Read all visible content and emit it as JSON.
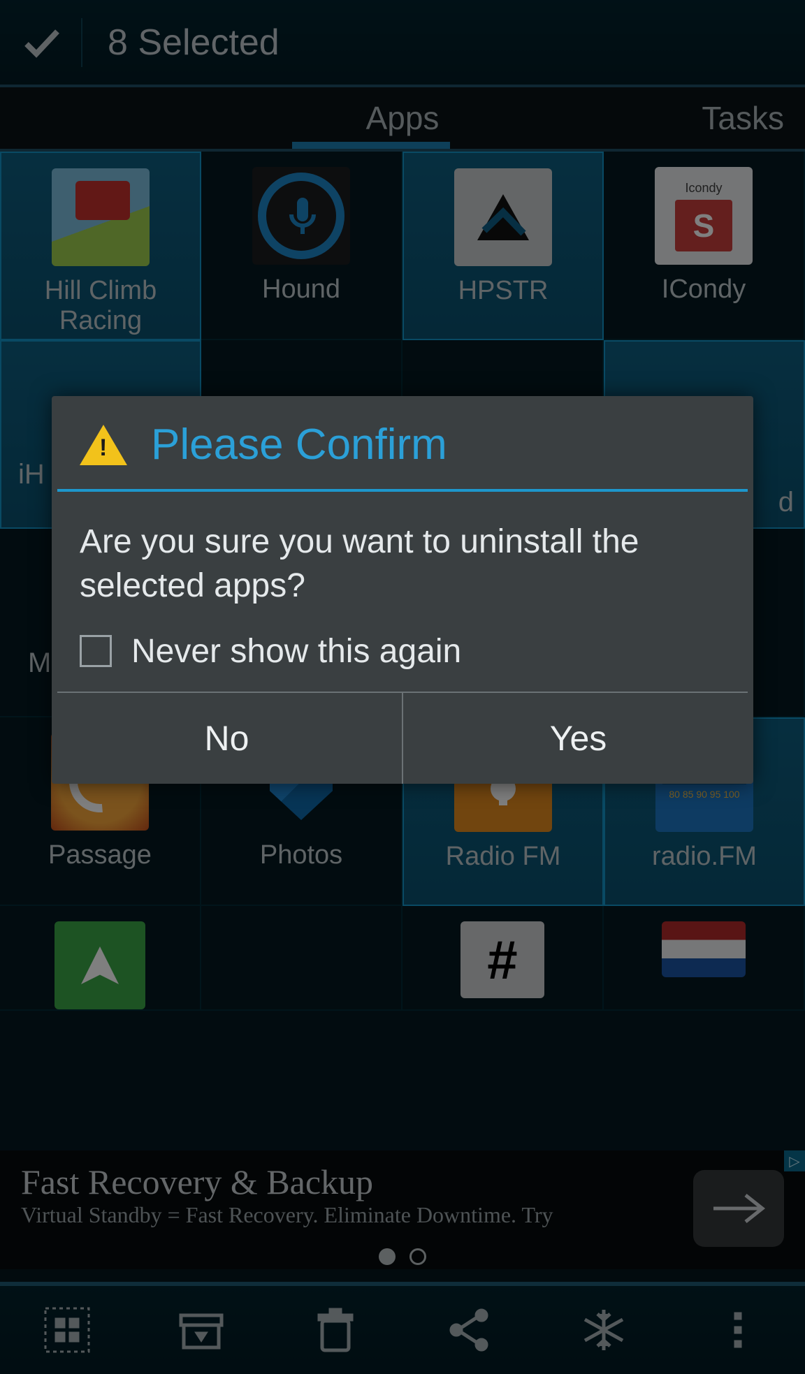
{
  "header": {
    "title": "8 Selected"
  },
  "tabs": {
    "apps": "Apps",
    "tasks": "Tasks"
  },
  "apps": {
    "row1": [
      {
        "label": "Hill Climb Racing",
        "selected": true,
        "icon": "ic-hill"
      },
      {
        "label": "Hound",
        "selected": false,
        "icon": "ic-hound"
      },
      {
        "label": "HPSTR",
        "selected": true,
        "icon": "ic-hpstr"
      },
      {
        "label": "ICondy",
        "selected": false,
        "icon": "ic-icondy"
      }
    ],
    "row2_fragments": {
      "left": "iH",
      "right": "d",
      "mid_left": "M"
    },
    "row4": [
      {
        "label": "Passage",
        "selected": false,
        "icon": "ic-passage"
      },
      {
        "label": "Photos",
        "selected": false,
        "icon": "ic-photos"
      },
      {
        "label": "Radio FM",
        "selected": true,
        "icon": "ic-radiofm"
      },
      {
        "label": "radio.FM",
        "selected": true,
        "icon": "ic-radiodotfm"
      }
    ]
  },
  "icondy_text": "Icondy",
  "icondy_letter": "S",
  "radiodotfm_nums": "80 85 90 95 100",
  "dialog": {
    "title": "Please Confirm",
    "body": "Are you sure you want to uninstall the selected apps?",
    "checkbox": "Never show this again",
    "no": "No",
    "yes": "Yes"
  },
  "ad": {
    "title": "Fast Recovery & Backup",
    "sub": "Virtual Standby = Fast Recovery. Eliminate Downtime. Try"
  }
}
